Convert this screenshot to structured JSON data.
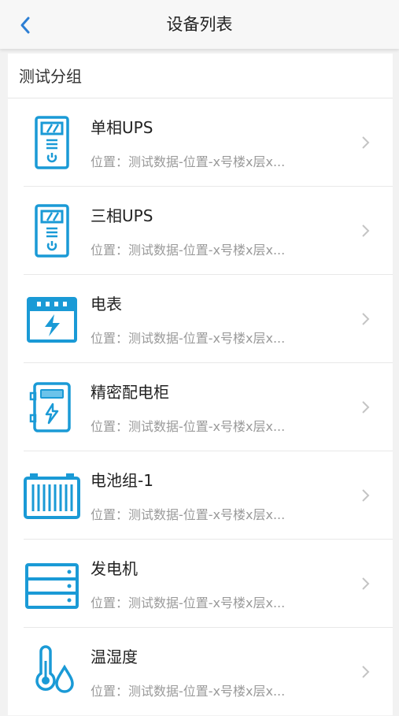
{
  "header": {
    "title": "设备列表",
    "back_icon": "chevron-left-icon",
    "accent_color": "#2d7fd4"
  },
  "group": {
    "title": "测试分组"
  },
  "devices": [
    {
      "name": "单相UPS",
      "location": "位置：测试数据-位置-x号楼x层x...",
      "icon": "ups-icon"
    },
    {
      "name": "三相UPS",
      "location": "位置：测试数据-位置-x号楼x层x...",
      "icon": "ups-icon"
    },
    {
      "name": "电表",
      "location": "位置：测试数据-位置-x号楼x层x...",
      "icon": "meter-icon"
    },
    {
      "name": "精密配电柜",
      "location": "位置：测试数据-位置-x号楼x层x...",
      "icon": "cabinet-icon"
    },
    {
      "name": "电池组-1",
      "location": "位置：测试数据-位置-x号楼x层x...",
      "icon": "battery-icon"
    },
    {
      "name": "发电机",
      "location": "位置：测试数据-位置-x号楼x层x...",
      "icon": "generator-icon"
    },
    {
      "name": "温湿度",
      "location": "位置：测试数据-位置-x号楼x层x...",
      "icon": "thermometer-humidity-icon"
    }
  ],
  "icon_color": "#1a9ad6"
}
